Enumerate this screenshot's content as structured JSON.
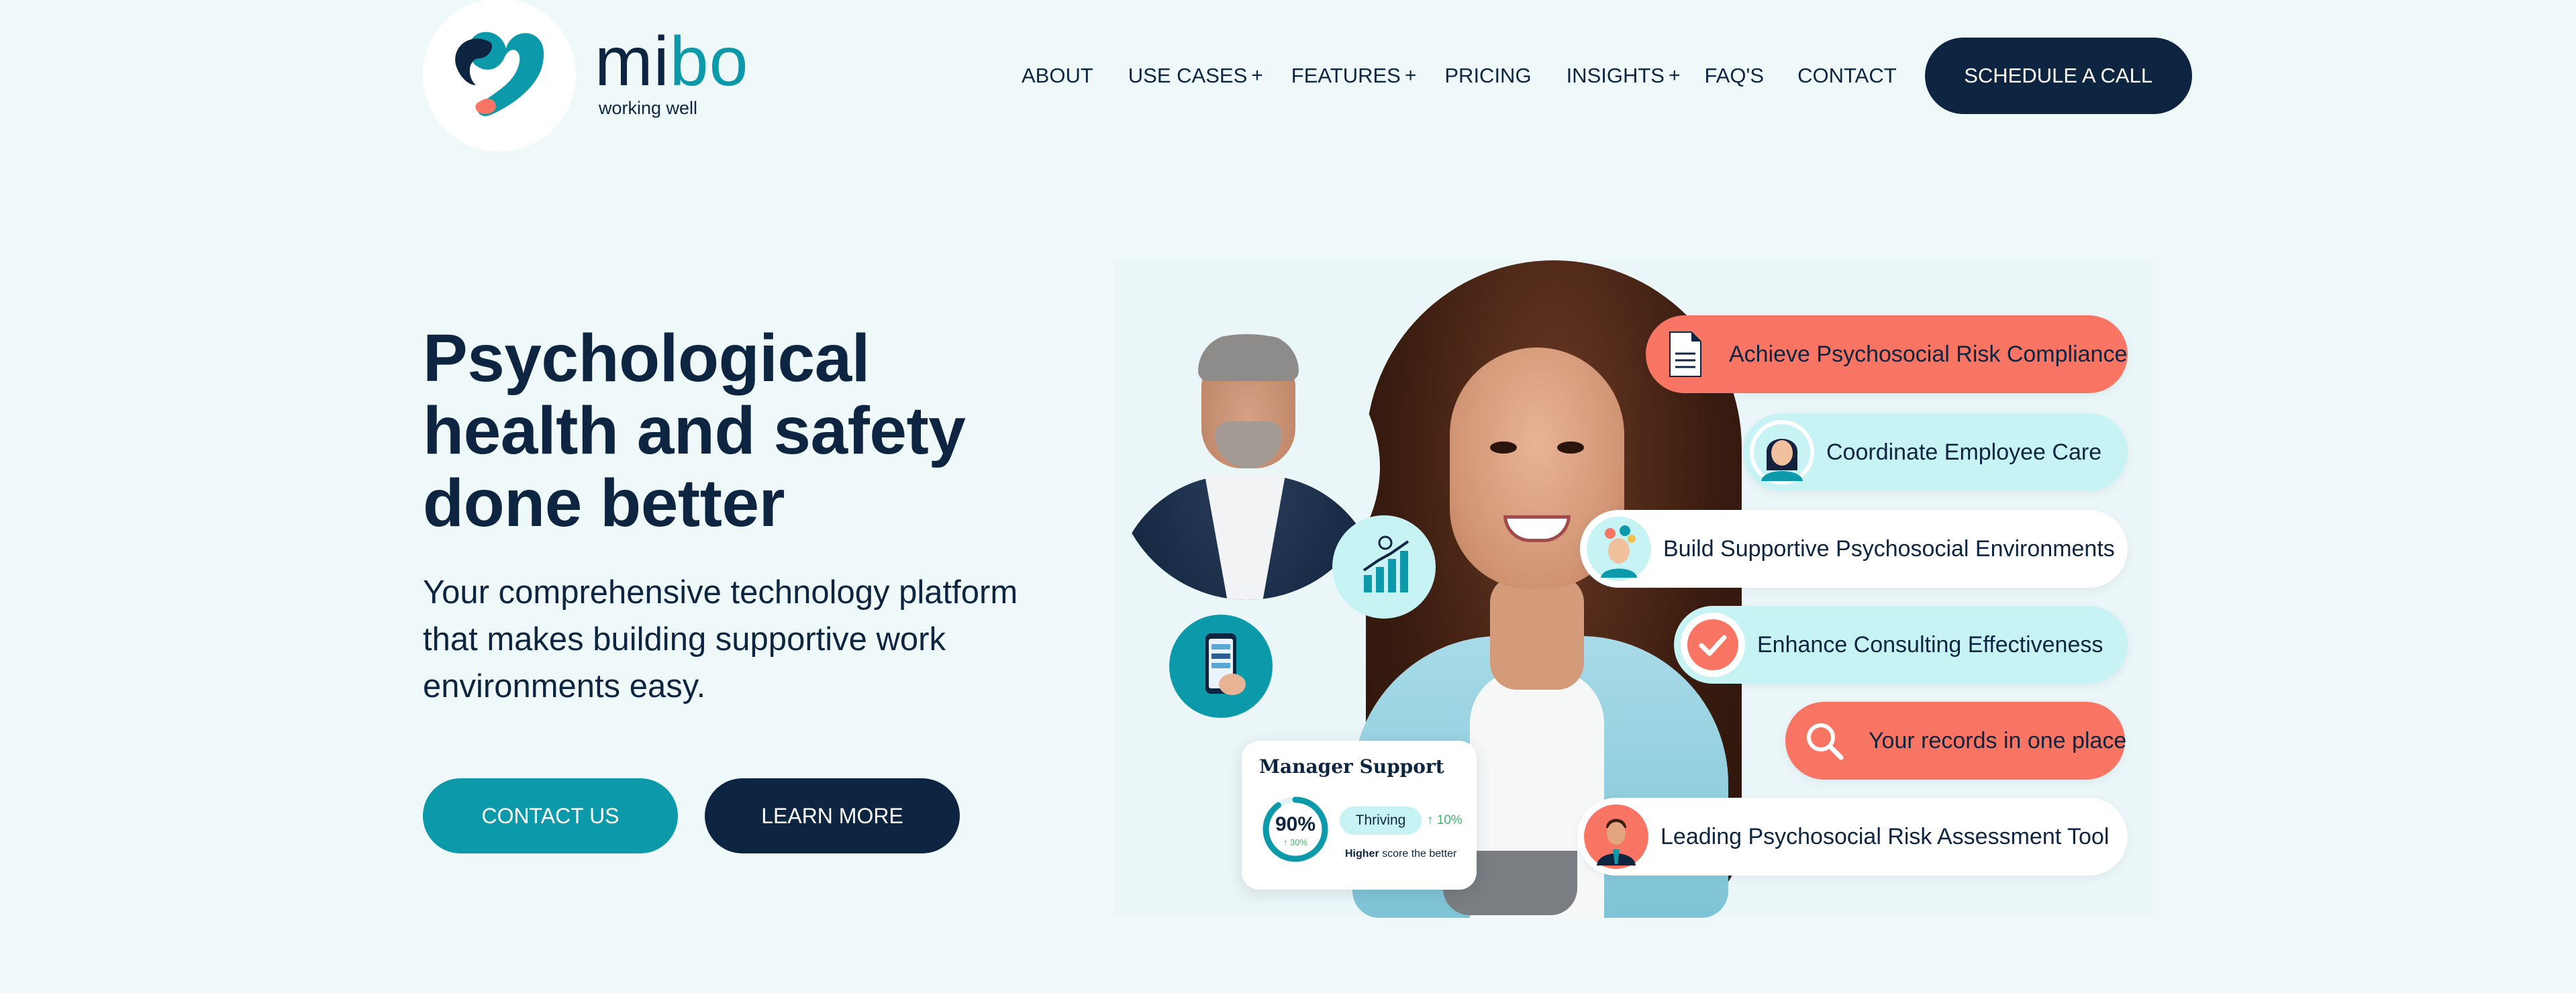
{
  "brand": {
    "name_part1": "mi",
    "name_part2": "bo",
    "tagline": "working well",
    "colors": {
      "navy": "#0d2540",
      "teal": "#0c9aab",
      "coral": "#f87564",
      "cyan_light": "#c8f3f5",
      "background": "#eff9fa"
    }
  },
  "nav": {
    "items": [
      {
        "label": "ABOUT",
        "has_submenu": false
      },
      {
        "label": "USE CASES",
        "has_submenu": true
      },
      {
        "label": "FEATURES",
        "has_submenu": true
      },
      {
        "label": "PRICING",
        "has_submenu": false
      },
      {
        "label": "INSIGHTS",
        "has_submenu": true
      },
      {
        "label": "FAQ'S",
        "has_submenu": false
      },
      {
        "label": "CONTACT",
        "has_submenu": false
      }
    ],
    "submenu_indicator": "+",
    "cta_label": "SCHEDULE A CALL"
  },
  "hero": {
    "title_line1": "Psychological",
    "title_line2": "health and safety",
    "title_line3": "done better",
    "subtitle": "Your comprehensive technology platform that makes building supportive work environments easy.",
    "primary_button": "CONTACT US",
    "secondary_button": "LEARN MORE"
  },
  "manager_card": {
    "title": "Manager Support",
    "percent": "90%",
    "percent_change": "↑ 30%",
    "status": "Thriving",
    "status_change": "↑ 10%",
    "note_bold": "Higher",
    "note_rest": " score the better",
    "ring_fill": 0.9
  },
  "features": [
    {
      "label": "Achieve Psychosocial Risk Compliance",
      "icon": "document-icon"
    },
    {
      "label": "Coordinate Employee Care",
      "icon": "woman-avatar-icon"
    },
    {
      "label": "Build Supportive Psychosocial Environments",
      "icon": "thinking-person-icon"
    },
    {
      "label": "Enhance Consulting Effectiveness",
      "icon": "checkmark-icon"
    },
    {
      "label": "Your records in one place",
      "icon": "search-icon"
    },
    {
      "label": "Leading Psychosocial Risk Assessment Tool",
      "icon": "businessman-avatar-icon"
    }
  ]
}
